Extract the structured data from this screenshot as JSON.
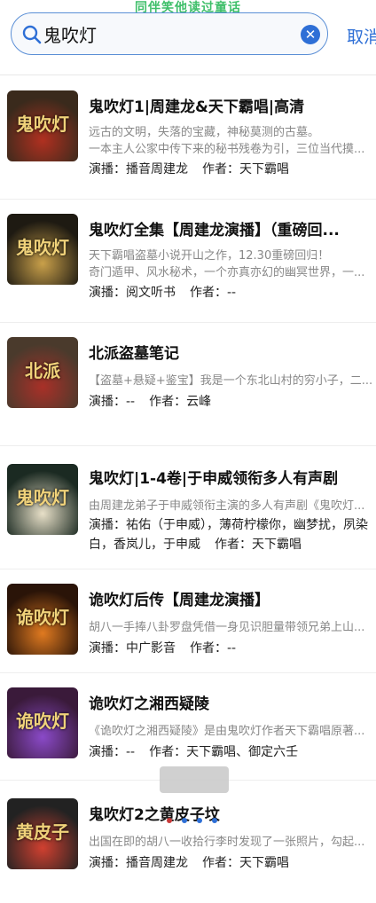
{
  "watermark": "同伴笑他读过童话",
  "search": {
    "value": "鬼吹灯",
    "cancel_label": "取消"
  },
  "results": [
    {
      "title": "鬼吹灯1|周建龙&天下霸唱|高清",
      "desc_lines": [
        "远古的文明，失落的宝藏，神秘莫测的古墓。",
        "一本主人公家中传下来的秘书残卷为引，三位当代摸..."
      ],
      "narrator_label": "演播：",
      "narrator": "播音周建龙",
      "author_label": "作者：",
      "author": "天下霸唱",
      "cover": {
        "text": "鬼吹灯",
        "bg": "#3a2a1c",
        "accent": "#b03020"
      }
    },
    {
      "title": "鬼吹灯全集【周建龙演播】（重磅回...",
      "desc_lines": [
        "天下霸唱盗墓小说开山之作，12.30重磅回归！",
        "奇门遁甲、风水秘术，一个亦真亦幻的幽冥世界，一..."
      ],
      "narrator_label": "演播：",
      "narrator": "阅文听书",
      "author_label": "作者：",
      "author": "--",
      "cover": {
        "text": "鬼吹灯",
        "bg": "#1e1a12",
        "accent": "#c9a04a"
      }
    },
    {
      "title": "北派盗墓笔记",
      "desc_lines": [
        "【盗墓+悬疑+鉴宝】我是一个东北山村的穷小子，二..."
      ],
      "narrator_label": "演播：",
      "narrator": "--",
      "author_label": "作者：",
      "author": "云峰",
      "cover": {
        "text": "北派",
        "bg": "#4a3a2c",
        "accent": "#a83028"
      }
    },
    {
      "title": "鬼吹灯|1-4卷|于申威领衔多人有声剧",
      "desc_lines": [
        "由周建龙弟子于申威领衔主演的多人有声剧《鬼吹灯..."
      ],
      "narrator_label": "演播：",
      "narrator": "祐佑（于申威），薄荷柠檬你，幽梦扰，夙染白，香岚儿，于申威",
      "author_label": "作者：",
      "author": "天下霸唱",
      "cover": {
        "text": "鬼吹灯",
        "bg": "#1b2a22",
        "accent": "#e8e0c8"
      }
    },
    {
      "title": "诡吹灯后传【周建龙演播】",
      "desc_lines": [
        "胡八一手捧八卦罗盘凭借一身见识胆量带领兄弟上山..."
      ],
      "narrator_label": "演播：",
      "narrator": "中广影音",
      "author_label": "作者：",
      "author": "--",
      "cover": {
        "text": "诡吹灯",
        "bg": "#2a1408",
        "accent": "#e07a20"
      }
    },
    {
      "title": "诡吹灯之湘西疑陵",
      "desc_lines": [
        "《诡吹灯之湘西疑陵》是由鬼吹灯作者天下霸唱原著..."
      ],
      "narrator_label": "演播：",
      "narrator": "--",
      "author_label": "作者：",
      "author": "天下霸唱、御定六壬",
      "cover": {
        "text": "诡吹灯",
        "bg": "#3a1a3a",
        "accent": "#8a4ac8"
      }
    },
    {
      "title": "鬼吹灯2之黄皮子坟",
      "desc_lines": [
        "出国在即的胡八一收拾行李时发现了一张照片，勾起..."
      ],
      "narrator_label": "演播：",
      "narrator": "播音周建龙",
      "author_label": "作者：",
      "author": "天下霸唱",
      "cover": {
        "text": "黄皮子",
        "bg": "#222222",
        "accent": "#d04030"
      }
    }
  ],
  "pager_dots": [
    "#c83a3a",
    "#2e6fd6",
    "#2e6fd6",
    "#2e6fd6"
  ]
}
